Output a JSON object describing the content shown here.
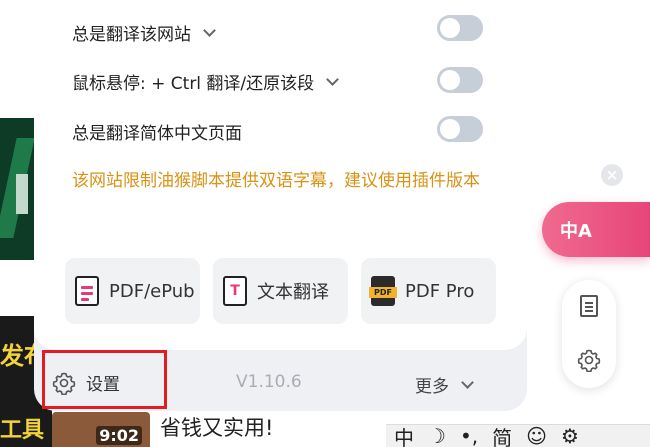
{
  "panel": {
    "rows": [
      {
        "label": "总是翻译该网站"
      },
      {
        "label": "鼠标悬停:  + Ctrl 翻译/还原该段"
      },
      {
        "label": "总是翻译简体中文页面"
      }
    ],
    "notice": "该网站限制油猴脚本提供双语字幕，建议使用插件版本",
    "tools": [
      {
        "label": "PDF/ePub",
        "icon": "pdf-epub-file-icon"
      },
      {
        "label": "文本翻译",
        "icon": "text-translate-icon"
      },
      {
        "label": "PDF Pro",
        "icon": "pdf-pro-icon"
      }
    ],
    "footer": {
      "settings_label": "设置",
      "version": "V1.10.6",
      "more_label": "更多"
    }
  },
  "floating": {
    "translate_badge": "中A",
    "close": "×"
  },
  "background": {
    "thumb_text": "发布",
    "bottom_label": "工具",
    "duration": "9:02",
    "video_title": "省钱又实用!",
    "ime_items": [
      "中",
      "☽",
      "•,",
      "简",
      "☺",
      "⚙"
    ]
  },
  "colors": {
    "accent": "#e7457a",
    "notice": "#d89214",
    "highlight": "#e31b23",
    "toggle_off": "#c6ced8"
  }
}
